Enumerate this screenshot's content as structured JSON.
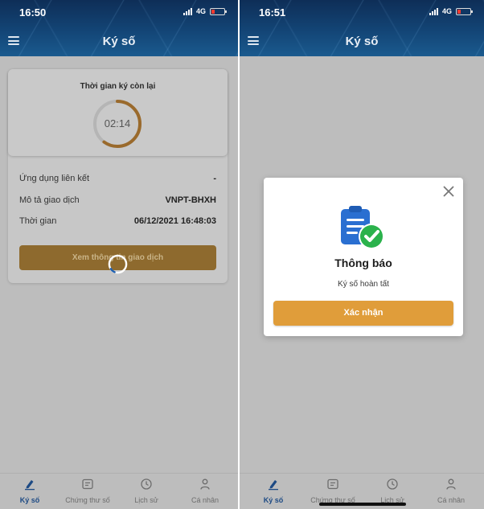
{
  "left": {
    "status_time": "16:50",
    "network": "4G",
    "title": "Ký số",
    "timer": {
      "label": "Thời gian ký còn lại",
      "value": "02:14",
      "progress": 0.6
    },
    "rows": [
      {
        "label": "Ứng dụng liên kết",
        "value": "-"
      },
      {
        "label": "Mô tả giao dịch",
        "value": "VNPT-BHXH"
      },
      {
        "label": "Thời gian",
        "value": "06/12/2021 16:48:03"
      }
    ],
    "detail_button": "Xem thông tin giao dịch",
    "tabs": [
      {
        "label": "Ký số",
        "icon": "pen-icon",
        "active": true
      },
      {
        "label": "Chứng thư số",
        "icon": "certificate-icon",
        "active": false
      },
      {
        "label": "Lịch sử",
        "icon": "clock-icon",
        "active": false
      },
      {
        "label": "Cá nhân",
        "icon": "person-icon",
        "active": false
      }
    ]
  },
  "right": {
    "status_time": "16:51",
    "network": "4G",
    "title": "Ký số",
    "modal": {
      "title": "Thông báo",
      "message": "Ký số hoàn tất",
      "confirm_label": "Xác nhận",
      "icon": "clipboard-check-icon"
    },
    "tabs": [
      {
        "label": "Ký số",
        "icon": "pen-icon",
        "active": true
      },
      {
        "label": "Chứng thư số",
        "icon": "certificate-icon",
        "active": false
      },
      {
        "label": "Lịch sử",
        "icon": "clock-icon",
        "active": false
      },
      {
        "label": "Cá nhân",
        "icon": "person-icon",
        "active": false
      }
    ]
  },
  "colors": {
    "header": "#134576",
    "accent_orange": "#e09d3a",
    "active_tab": "#1d4a84",
    "success_green": "#2bb24c",
    "doc_blue": "#2a6fd1"
  }
}
